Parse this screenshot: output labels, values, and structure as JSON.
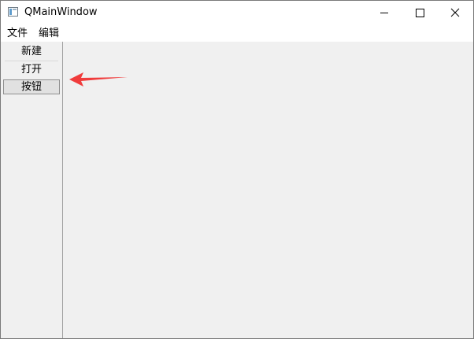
{
  "window": {
    "title": "QMainWindow",
    "icon": "qt-window-icon"
  },
  "titlebar_buttons": {
    "minimize": "minimize-icon",
    "maximize": "maximize-icon",
    "close": "close-icon"
  },
  "menubar": {
    "items": [
      {
        "label": "文件"
      },
      {
        "label": "编辑"
      }
    ]
  },
  "toolbar": {
    "items": [
      {
        "label": "新建"
      },
      {
        "label": "打开"
      },
      {
        "label": "按钮"
      }
    ]
  },
  "annotation": {
    "icon": "red-arrow-icon",
    "color": "#f03c3c"
  }
}
